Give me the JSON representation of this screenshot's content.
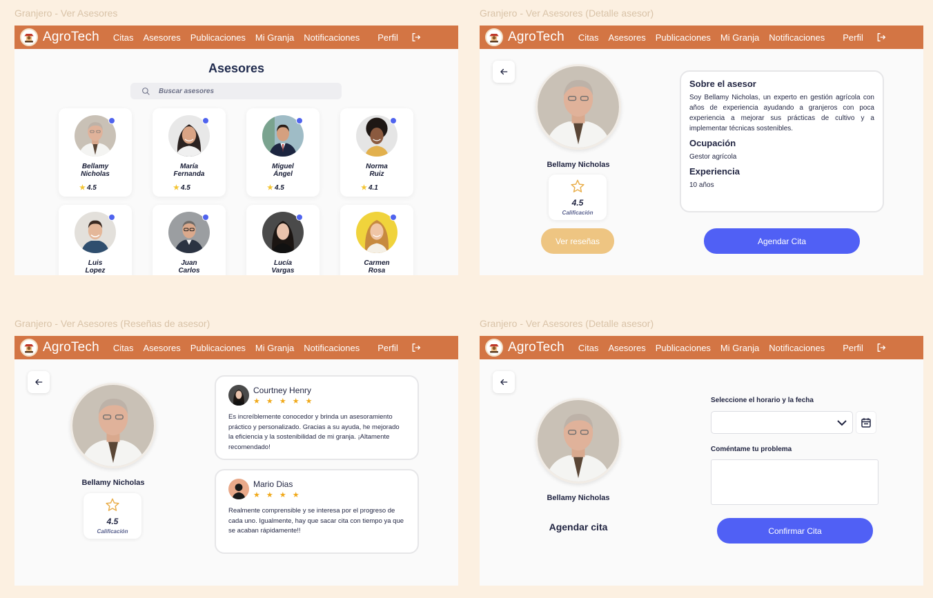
{
  "app": {
    "brand": "AgroTech"
  },
  "nav": {
    "items": [
      "Citas",
      "Asesores",
      "Publicaciones",
      "Mi Granja",
      "Notificaciones",
      "Perfil"
    ]
  },
  "frames": {
    "list": {
      "label": "Granjero - Ver Asesores"
    },
    "detail": {
      "label": "Granjero - Ver Asesores (Detalle asesor)"
    },
    "reviews": {
      "label": "Granjero - Ver Asesores (Reseñas de asesor)"
    },
    "booking": {
      "label": "Granjero - Ver Asesores (Detalle asesor)"
    }
  },
  "list": {
    "title": "Asesores",
    "search_placeholder": "Buscar asesores",
    "advisors": [
      {
        "name1": "Bellamy",
        "name2": "Nicholas",
        "rating": "4.5"
      },
      {
        "name1": "María",
        "name2": "Fernanda",
        "rating": "4.5"
      },
      {
        "name1": "Miguel",
        "name2": "Ángel",
        "rating": "4.5"
      },
      {
        "name1": "Norma",
        "name2": "Ruiz",
        "rating": "4.1"
      },
      {
        "name1": "Luis",
        "name2": "Lopez",
        "rating": ""
      },
      {
        "name1": "Juan",
        "name2": "Carlos",
        "rating": ""
      },
      {
        "name1": "Lucía",
        "name2": "Vargas",
        "rating": ""
      },
      {
        "name1": "Carmen",
        "name2": "Rosa",
        "rating": ""
      }
    ]
  },
  "advisor": {
    "name": "Bellamy Nicholas",
    "rating": "4.5",
    "rating_label": "Calificación",
    "about_title": "Sobre el asesor",
    "about_text": "Soy Bellamy Nicholas, un experto en gestión agrícola con años de experiencia ayudando a granjeros con poca experiencia a mejorar sus prácticas de cultivo y a implementar técnicas sostenibles.",
    "occupation_title": "Ocupación",
    "occupation": "Gestor agrícola",
    "experience_title": "Experiencia",
    "experience": "10 años",
    "reviews_button": "Ver reseñas",
    "schedule_button": "Agendar Cita"
  },
  "reviews": [
    {
      "author": "Courtney Henry",
      "stars": "★ ★ ★ ★ ★",
      "text": "Es increíblemente conocedor y brinda un asesoramiento práctico y personalizado. Gracias a su ayuda, he mejorado la eficiencia y la sostenibilidad de mi granja. ¡Altamente recomendado!"
    },
    {
      "author": "Mario Dias",
      "stars": "★ ★ ★ ★",
      "text": "Realmente comprensible y se interesa por el progreso de cada uno. Igualmente, hay que sacar cita con tiempo ya que se acaban rápidamente!!"
    }
  ],
  "booking": {
    "date_label": "Seleccione el horario y la fecha",
    "problem_label": "Coméntame tu problema",
    "heading": "Agendar cita",
    "confirm_button": "Confirmar Cita"
  },
  "colors": {
    "nav": "#d37544",
    "primary": "#5060f5",
    "secondary": "#eec582",
    "background": "#fcf0e1"
  }
}
